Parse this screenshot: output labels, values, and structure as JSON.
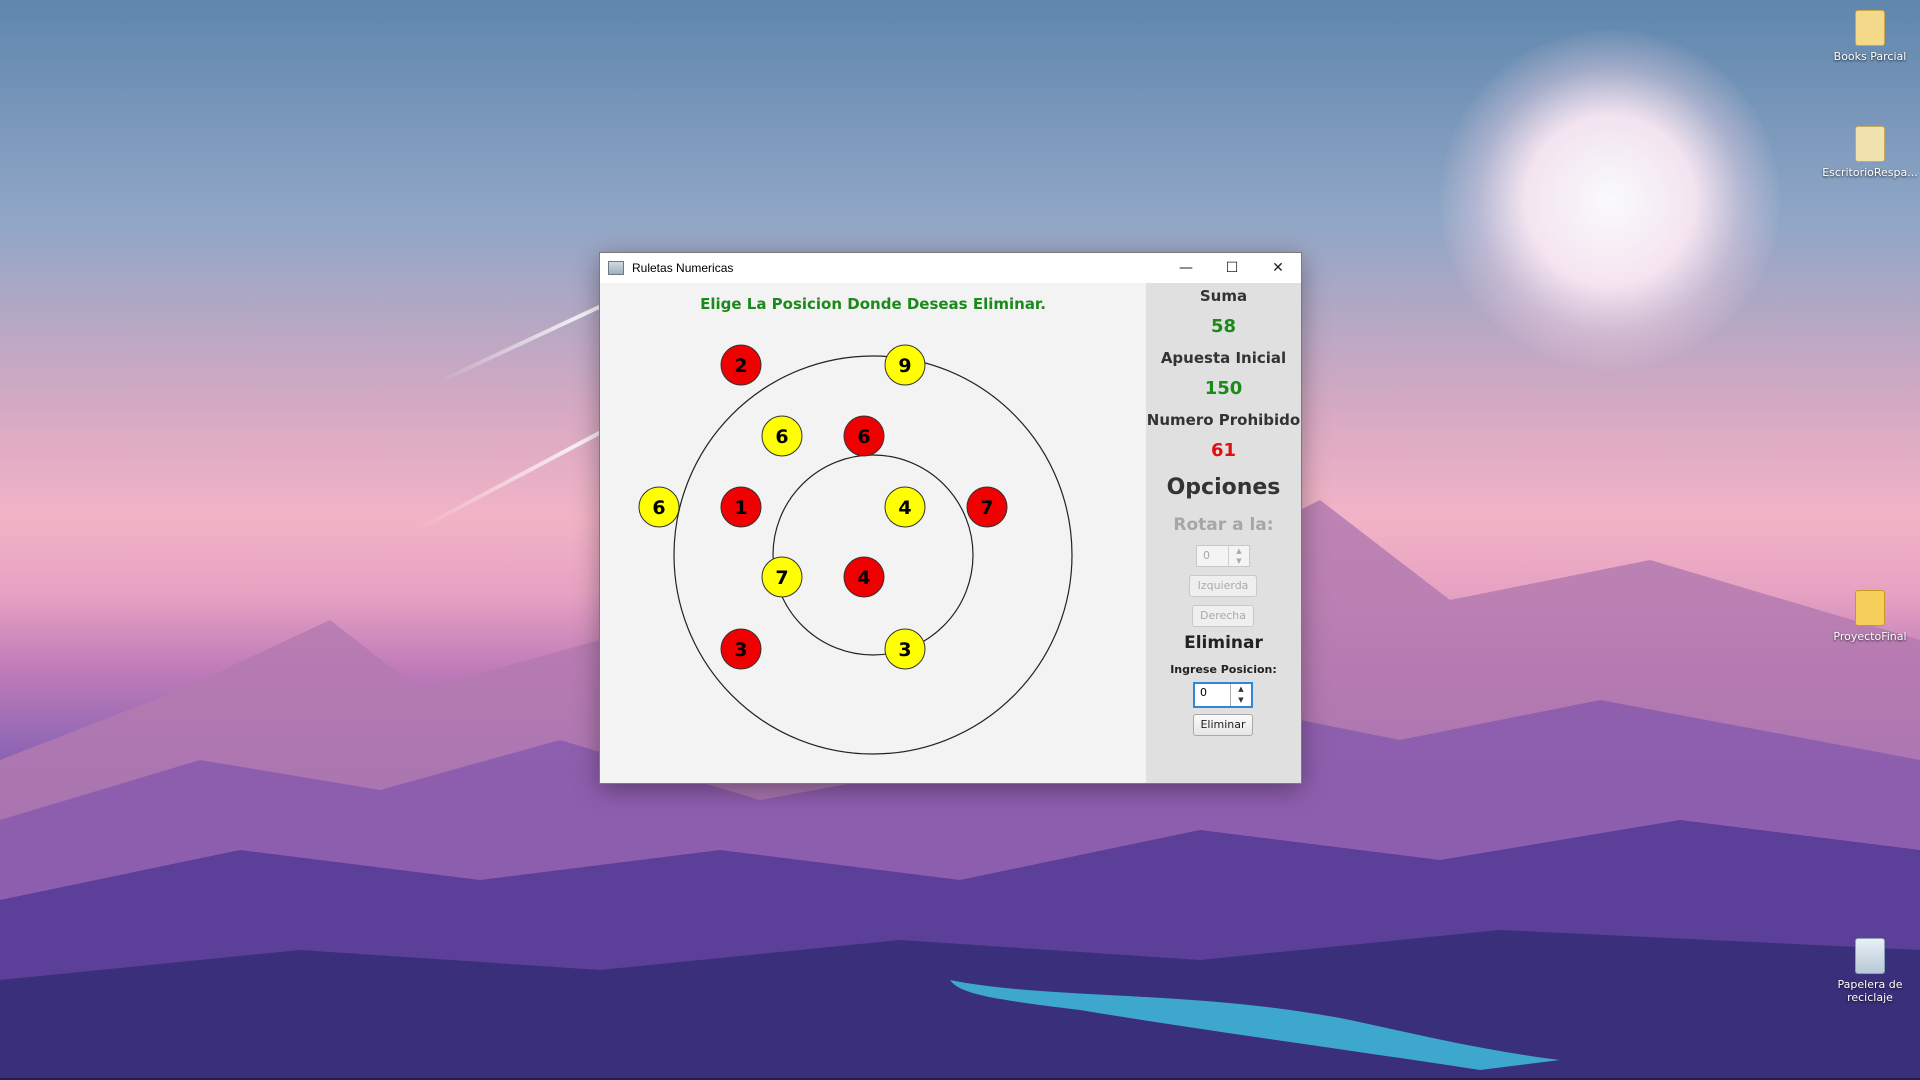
{
  "desktop": {
    "icons": [
      {
        "label": "Books Parcial"
      },
      {
        "label": "EscritorioRespa..."
      },
      {
        "label": "ProyectoFinal"
      },
      {
        "label": "Papelera de reciclaje"
      }
    ]
  },
  "window": {
    "title": "Ruletas Numericas",
    "controls": {
      "minimize": "—",
      "maximize": "☐",
      "close": "✕"
    },
    "instruction": "Elige La Posicion Donde Deseas Eliminar.",
    "outer_ring": {
      "numbers": [
        {
          "value": "2",
          "color": "#f00000"
        },
        {
          "value": "9",
          "color": "#ffff00"
        },
        {
          "value": "7",
          "color": "#f00000"
        },
        {
          "value": "3",
          "color": "#ffff00"
        },
        {
          "value": "3",
          "color": "#f00000"
        },
        {
          "value": "6",
          "color": "#ffff00"
        }
      ]
    },
    "inner_ring": {
      "numbers": [
        {
          "value": "6",
          "color": "#ffff00"
        },
        {
          "value": "6",
          "color": "#f00000"
        },
        {
          "value": "4",
          "color": "#ffff00"
        },
        {
          "value": "4",
          "color": "#f00000"
        },
        {
          "value": "7",
          "color": "#ffff00"
        },
        {
          "value": "1",
          "color": "#f00000"
        }
      ]
    },
    "side": {
      "suma_label": "Suma",
      "suma_value": "58",
      "apuesta_label": "Apuesta Inicial",
      "apuesta_value": "150",
      "prohibido_label": "Numero Prohibido",
      "prohibido_value": "61",
      "opciones_label": "Opciones",
      "rotar_label": "Rotar a la:",
      "rotar_value": "0",
      "izquierda_label": "Izquierda",
      "derecha_label": "Derecha",
      "eliminar_title": "Eliminar",
      "posicion_label": "Ingrese Posicion:",
      "posicion_value": "0",
      "eliminar_button": "Eliminar"
    }
  }
}
